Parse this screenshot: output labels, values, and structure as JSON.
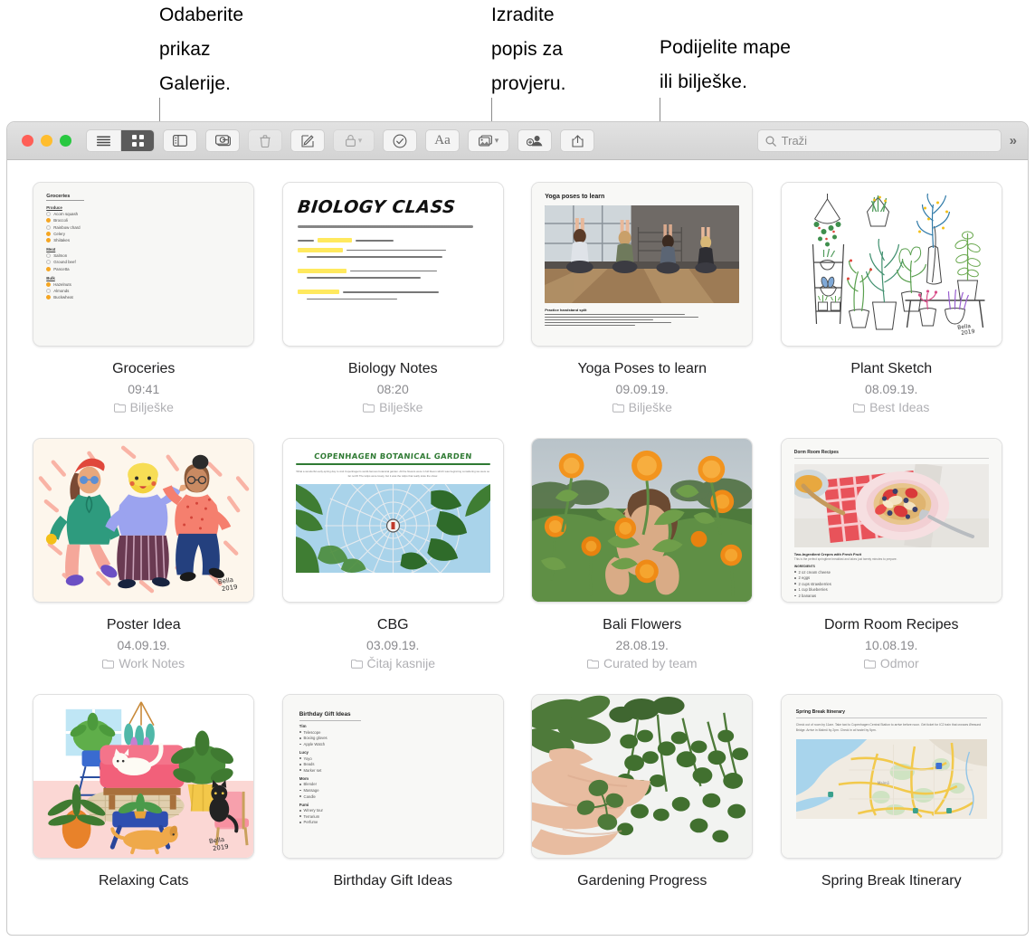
{
  "callouts": [
    {
      "text": "Odaberite\nprikaz\nGalerije.",
      "target": "gallery-view-button"
    },
    {
      "text": "Izradite\npopis za\nprovjeru.",
      "target": "checklist-button"
    },
    {
      "text": "Podijelite mape\nili bilješke.",
      "target": "share-collaborate-button"
    }
  ],
  "toolbar": {
    "window_controls": [
      "close",
      "minimize",
      "zoom"
    ],
    "view_segment": [
      {
        "icon": "list-view-icon",
        "label": "List View",
        "active": false
      },
      {
        "icon": "gallery-view-icon",
        "label": "Gallery View",
        "active": true
      }
    ],
    "buttons": [
      {
        "icon": "sidebar-icon",
        "label": "Prikaži rubni stupac",
        "dim": false
      },
      {
        "icon": "new-folder-icon",
        "label": "Nova mapa",
        "dim": false
      },
      {
        "icon": "trash-icon",
        "label": "Izbriši",
        "dim": true
      },
      {
        "icon": "compose-icon",
        "label": "Nova bilješka",
        "dim": false
      },
      {
        "icon": "lock-icon",
        "label": "Zaključaj",
        "dim": true,
        "caret": true
      },
      {
        "icon": "checklist-icon",
        "label": "Popis za provjeru",
        "dim": false
      },
      {
        "icon": "format-aa-icon",
        "label": "Aa",
        "dim": false,
        "text": "Aa"
      },
      {
        "icon": "media-icon",
        "label": "Mediji",
        "dim": false,
        "caret": true
      },
      {
        "icon": "add-person-icon",
        "label": "Dodaj osobe",
        "dim": false
      },
      {
        "icon": "share-icon",
        "label": "Dijeli",
        "dim": false
      }
    ],
    "search": {
      "placeholder": "Traži",
      "icon": "search-icon"
    },
    "overflow": {
      "icon": "chevrons-right-icon",
      "label": "»"
    }
  },
  "notes": [
    {
      "title": "Groceries",
      "date": "09:41",
      "folder": "Bilješke",
      "thumb": "groceries-checklist"
    },
    {
      "title": "Biology Notes",
      "date": "08:20",
      "folder": "Bilješke",
      "thumb": "biology-handwriting"
    },
    {
      "title": "Yoga Poses to learn",
      "date": "09.09.19.",
      "folder": "Bilješke",
      "thumb": "yoga-photo"
    },
    {
      "title": "Plant Sketch",
      "date": "08.09.19.",
      "folder": "Best Ideas",
      "thumb": "plant-sketch"
    },
    {
      "title": "Poster Idea",
      "date": "04.09.19.",
      "folder": "Work Notes",
      "thumb": "poster-illustration"
    },
    {
      "title": "CBG",
      "date": "03.09.19.",
      "folder": "Čitaj kasnije",
      "thumb": "botanical-garden"
    },
    {
      "title": "Bali Flowers",
      "date": "28.08.19.",
      "folder": "Curated by team",
      "thumb": "bali-photo"
    },
    {
      "title": "Dorm Room Recipes",
      "date": "10.08.19.",
      "folder": "Odmor",
      "thumb": "recipe-photo"
    },
    {
      "title": "Relaxing Cats",
      "date": "",
      "folder": "",
      "thumb": "cats-illustration"
    },
    {
      "title": "Birthday Gift Ideas",
      "date": "",
      "folder": "",
      "thumb": "gift-ideas-list"
    },
    {
      "title": "Gardening Progress",
      "date": "",
      "folder": "",
      "thumb": "gardening-photo"
    },
    {
      "title": "Spring Break Itinerary",
      "date": "",
      "folder": "",
      "thumb": "itinerary-map"
    }
  ],
  "thumb_content": {
    "groceries": {
      "title": "Groceries",
      "sections": [
        {
          "name": "Produce",
          "items": [
            {
              "text": "Acorn squash",
              "checked": false
            },
            {
              "text": "Broccoli",
              "checked": true
            },
            {
              "text": "Rainbow chard",
              "checked": false
            },
            {
              "text": "Celery",
              "checked": true
            },
            {
              "text": "Shiitakes",
              "checked": true
            }
          ]
        },
        {
          "name": "Meat",
          "items": [
            {
              "text": "Salmon",
              "checked": false
            },
            {
              "text": "Ground beef",
              "checked": false
            },
            {
              "text": "Pancetta",
              "checked": true
            }
          ]
        },
        {
          "name": "Bulk",
          "items": [
            {
              "text": "Hazelnuts",
              "checked": true
            },
            {
              "text": "Almonds",
              "checked": false
            },
            {
              "text": "Buckwheat",
              "checked": true
            }
          ]
        }
      ]
    },
    "biology": {
      "title": "BIOLOGY CLASS",
      "subtitle": "ADENOSINE TRIPHOSPHATE (ATP) — THE ENERGY CURRENCY OF LIFE."
    },
    "yoga": {
      "title": "Yoga poses to learn",
      "caption": "Practice handstand split"
    },
    "cbg": {
      "title": "COPENHAGEN BOTANICAL GARDEN",
      "body": "What a wonderful early-spring day to visit Copenhagen's world-famous botanical garden. All the flowers were in full bloom which was beginning considering we were so far north! The tulips were lovely, but it was the tulips that really stole the show."
    },
    "recipes": {
      "title": "Dorm Room Recipes",
      "subtitle": "Two-Ingredient Crepes with Fresh Fruit",
      "desc": "This is the perfect springtime breakfast and takes just twenty minutes to prepare.",
      "list_title": "INGREDIENTS",
      "items": [
        "2 oz cream cheese",
        "2 eggs",
        "2 cups strawberries",
        "1 cup blueberries",
        "2 bananas"
      ]
    },
    "gifts": {
      "title": "Birthday Gift Ideas",
      "groups": [
        {
          "name": "Tim",
          "items": [
            "Telescope",
            "Boxing gloves",
            "Apple Watch"
          ]
        },
        {
          "name": "Lucy",
          "items": [
            "Yoyo",
            "Beads",
            "Marker set"
          ]
        },
        {
          "name": "Mom",
          "items": [
            "Blender",
            "Massage",
            "Candle"
          ]
        },
        {
          "name": "Fumi",
          "items": [
            "Winery tour",
            "Terrarium",
            "Perfume"
          ]
        }
      ]
    },
    "itinerary": {
      "title": "Spring Break Itinerary",
      "body": "Check out of room by 11am. Take taxi to Copenhagen Central Station to arrive before noon. Get ticket for IC2 train that crosses Øresund Bridge. Arrive in Malmö by 2pm. Check in at hostel by 5pm."
    }
  },
  "colors": {
    "accent_orange": "#f5a623",
    "highlight_yellow": "#ffe95e",
    "toolbar_bg": "#d8d8d8",
    "active_segment": "#5b5b5b",
    "title_text": "#1d1d1f",
    "date_text": "#8a8a8e",
    "folder_text": "#b0b0b4"
  }
}
